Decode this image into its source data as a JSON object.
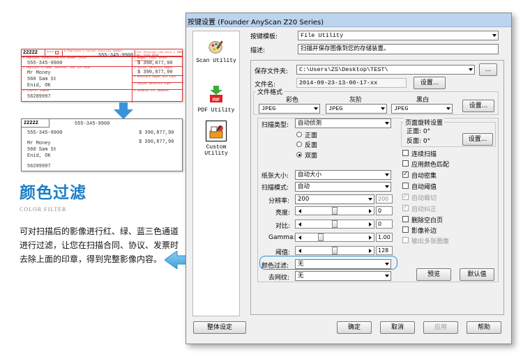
{
  "promo": {
    "title": "颜色过滤",
    "subtitle": "COLOR FILTER",
    "description": "可对扫描后的影像进行红、绿、蓝三色通道进行过滤，让您在扫描合同、协议、发票时去除上面的印章，得到完整影像内容。"
  },
  "form_before": {
    "number": "22222",
    "void_label": "Void",
    "hdr_label": "a Employee's social security number",
    "hdr_label2": "For Official Use Only ▸ OMB No. 1545-0008",
    "ssn": "555-345-9900",
    "ein_label": "b Employer identification number (EIN)",
    "ein": "555-345-9900",
    "wages_label": "1 Wages, tips, other compensation",
    "wages": "$ 390,877,90",
    "ss_wages_label": "3 Social security wages",
    "ss_wages": "$ 390,877,90",
    "medicare_label": "5 Medicare wages and tips",
    "ss_tips_label": "7 Social security tips",
    "employer_label": "c Employer's name, address, and ZIP code",
    "name": "Mr Money",
    "address1": "560 Sam St",
    "address2": "Enid, OK",
    "control_label": "d Control number",
    "control": "56289997",
    "eic_label": "9 Advance EIC payment"
  },
  "form_after": {
    "number": "22222",
    "ssn": "555-345-9900",
    "ein": "555-345-9900",
    "wages": "$ 390,877,90",
    "ss_wages": "$ 390,877,90",
    "name": "Mr Money",
    "address1": "560 Sam St",
    "address2": "Enid, OK",
    "control": "56289997"
  },
  "dialog": {
    "title": "按键设置 (Founder AnyScan Z20 Series)",
    "sidebar": [
      {
        "label": "Scan Utility",
        "icon": "scan-utility-icon"
      },
      {
        "label": "PDF Utility",
        "icon": "pdf-icon",
        "badge": "PDF"
      },
      {
        "label": "Custom Utility",
        "icon": "custom-utility-icon"
      }
    ],
    "template_label": "按键模板:",
    "template_value": "File Utility",
    "desc_label": "描述:",
    "desc_value": "扫描并保存图像到您的存储装置。",
    "save_folder_label": "保存文件夹:",
    "save_folder_value": "C:\\Users\\ZS\\Desktop\\TEST\\",
    "browse_label": "...",
    "filename_label": "文件名:",
    "filename_value": "2014-09-23-13-00-17-xx",
    "filename_settings": "设置...",
    "file_format": {
      "title": "文件格式",
      "cols": [
        "彩色",
        "灰阶",
        "黑白"
      ],
      "values": [
        "JPEG",
        "JPEG",
        "JPEG"
      ],
      "settings": "设置..."
    },
    "scan_type_label": "扫描类型:",
    "scan_type_value": "自动侦测",
    "sides": {
      "front": "正面",
      "back": "反面",
      "duplex": "双面",
      "selected": "duplex"
    },
    "rotation": {
      "title": "页面旋转设置",
      "front": "正面: 0°",
      "back": "反面: 0°",
      "settings": "设置..."
    },
    "options": [
      {
        "label": "连续扫描",
        "checked": false,
        "disabled": false
      },
      {
        "label": "应用颜色匹配",
        "checked": false,
        "disabled": false
      },
      {
        "label": "自动密集",
        "checked": true,
        "disabled": false
      },
      {
        "label": "自动阈值",
        "checked": false,
        "disabled": false
      },
      {
        "label": "自动裁切",
        "checked": true,
        "disabled": true
      },
      {
        "label": "自动纠正",
        "checked": true,
        "disabled": true
      },
      {
        "label": "删除空白页",
        "checked": false,
        "disabled": false
      },
      {
        "label": "影像补边",
        "checked": false,
        "disabled": false
      },
      {
        "label": "输出多张图像",
        "checked": false,
        "disabled": true
      }
    ],
    "paper_size_label": "纸张大小:",
    "paper_size_value": "自动大小",
    "scan_mode_label": "扫描模式:",
    "scan_mode_value": "自动",
    "resolution_label": "分辨率:",
    "resolution_value": "200",
    "resolution_box": "200",
    "brightness_label": "亮度:",
    "brightness_value": "0",
    "brightness_level": 0.5,
    "contrast_label": "对比:",
    "contrast_value": "0",
    "contrast_level": 0.5,
    "gamma_label": "Gamma:",
    "gamma_value": "1.00",
    "gamma_level": 0.25,
    "threshold_label": "阈值:",
    "threshold_value": "128",
    "threshold_level": 0.5,
    "color_filter_label": "颜色过滤:",
    "color_filter_value": "无",
    "descreen_label": "去网纹:",
    "descreen_value": "无",
    "preview_label": "预览",
    "default_label": "默认值",
    "overall_settings": "整体设定",
    "ok": "确定",
    "cancel": "取消",
    "apply": "应用",
    "help": "帮助"
  },
  "colors": {
    "accent": "#1a7fc8",
    "stamp_red": "#d33333",
    "highlight": "#2a8fd0"
  }
}
